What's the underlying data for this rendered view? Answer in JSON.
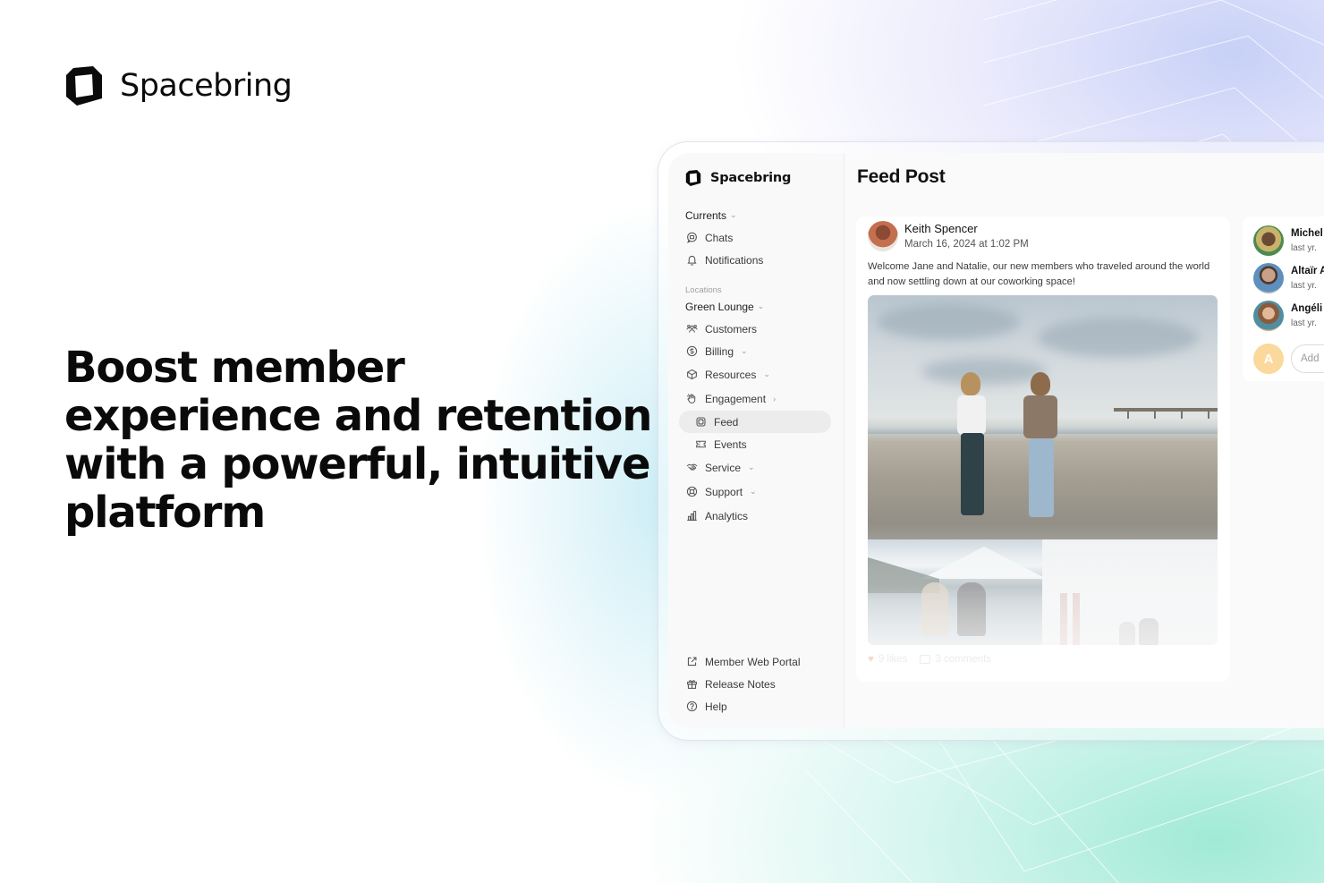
{
  "brand": {
    "name": "Spacebring",
    "icon": "spacebring-logo-icon"
  },
  "headline": "Boost member experience and retention with a powerful, intuitive platform",
  "colors": {
    "text": "#0a0a0a",
    "bg_top_right": "#c4cef6",
    "bg_bottom_right": "#96e8d0",
    "sidebar_active": "#ececec",
    "add_avatar": "#fbd89b"
  },
  "app": {
    "sidebar": {
      "brand": "Spacebring",
      "group_currents": {
        "label": "Currents",
        "chevron": "chevron-down-icon"
      },
      "currents_items": [
        {
          "label": "Chats",
          "icon": "chat-icon"
        },
        {
          "label": "Notifications",
          "icon": "bell-icon"
        }
      ],
      "section_locations": "Locations",
      "location": {
        "label": "Green Lounge",
        "chevron": "chevron-down-icon"
      },
      "items": [
        {
          "label": "Customers",
          "icon": "customers-icon",
          "chevron": ""
        },
        {
          "label": "Billing",
          "icon": "dollar-icon",
          "chevron": "⌄"
        },
        {
          "label": "Resources",
          "icon": "cube-icon",
          "chevron": "⌄"
        },
        {
          "label": "Engagement",
          "icon": "hand-icon",
          "chevron": "›"
        }
      ],
      "engagement_sub": [
        {
          "label": "Feed",
          "icon": "feed-icon",
          "active": true
        },
        {
          "label": "Events",
          "icon": "ticket-icon",
          "active": false
        }
      ],
      "items_after": [
        {
          "label": "Service",
          "icon": "handshake-icon",
          "chevron": "⌄"
        },
        {
          "label": "Support",
          "icon": "lifebuoy-icon",
          "chevron": "⌄"
        },
        {
          "label": "Analytics",
          "icon": "chart-icon",
          "chevron": ""
        }
      ],
      "footer": [
        {
          "label": "Member Web Portal",
          "icon": "external-link-icon"
        },
        {
          "label": "Release Notes",
          "icon": "gift-icon"
        },
        {
          "label": "Help",
          "icon": "help-icon"
        }
      ]
    },
    "main": {
      "title": "Feed Post",
      "post": {
        "author": "Keith Spencer",
        "timestamp": "March 16, 2024 at 1:02 PM",
        "text": "Welcome Jane and Natalie, our new members who traveled around the world and now settling down at our coworking space!",
        "photos": [
          "beach-photo",
          "mountain-lake-photo",
          "golden-gate-photo"
        ],
        "likes": "9 likes",
        "comments": "3 comments"
      },
      "comments_panel": {
        "items": [
          {
            "name": "Michel",
            "time": "last yr."
          },
          {
            "name": "Altaïr A",
            "time": "last yr."
          },
          {
            "name": "Angéli",
            "time": "last yr."
          }
        ],
        "add_avatar_initial": "A",
        "add_placeholder": "Add"
      }
    }
  }
}
